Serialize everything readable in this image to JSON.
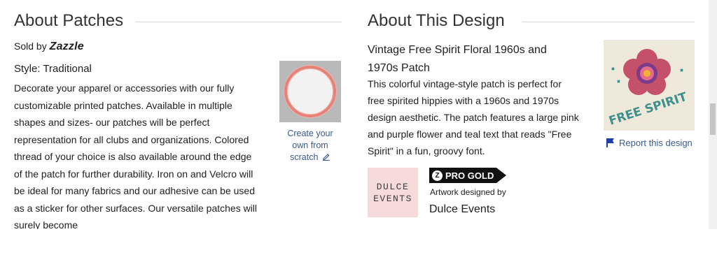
{
  "about_patches": {
    "title": "About Patches",
    "sold_by_label": "Sold by",
    "sold_by_brand": "Zazzle",
    "style": "Style: Traditional",
    "description": "Decorate your apparel or accessories with our fully customizable printed patches. Available in multiple shapes and sizes- our patches will be perfect representation for all clubs and organizations. Colored thread of your choice is also available around the edge of the patch for further durability. Iron on and Velcro will be ideal for many fabrics and our adhesive can be used as a sticker for other surfaces. Our versatile patches will surely become",
    "create_link": "Create your own from scratch"
  },
  "about_design": {
    "title": "About This Design",
    "design_title": "Vintage Free Spirit Floral 1960s and 1970s Patch",
    "description": "This colorful vintage-style patch is perfect for free spirited hippies with a 1960s and 1970s design aesthetic. The patch features a large pink and purple flower and teal text that reads \"Free Spirit\" in a fun, groovy font.",
    "report_link": "Report this design",
    "store_logo_line1": "DULCE",
    "store_logo_line2": "EVENTS",
    "badge": "PRO GOLD",
    "artwork_by": "Artwork designed by",
    "designer": "Dulce Events",
    "thumbnail_text": "FREE SPIRIT"
  },
  "colors": {
    "link": "#3a5a8c",
    "text": "#212121",
    "rule": "#d9d9d9",
    "store_logo_bg": "#f7dada"
  },
  "icons": [
    "flag-icon",
    "pencil-icon",
    "pro-gold-z-icon"
  ]
}
